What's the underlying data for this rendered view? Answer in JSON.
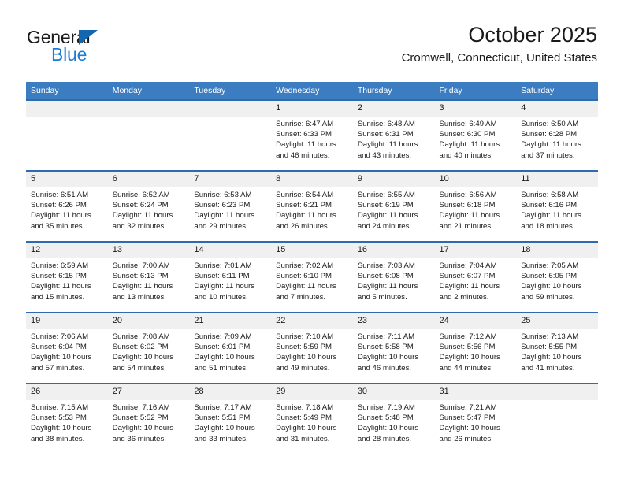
{
  "brand": {
    "line1": "General",
    "line2": "Blue",
    "triangle_color": "#1466b0",
    "blue_color": "#1b7cd6"
  },
  "header": {
    "title": "October 2025",
    "subtitle": "Cromwell, Connecticut, United States"
  },
  "theme": {
    "header_blue": "#3c7cc0",
    "border_blue": "#2e6bad",
    "daynum_bg": "#f0f0f0"
  },
  "columns": [
    "Sunday",
    "Monday",
    "Tuesday",
    "Wednesday",
    "Thursday",
    "Friday",
    "Saturday"
  ],
  "labels": {
    "sunrise": "Sunrise:",
    "sunset": "Sunset:",
    "daylight": "Daylight:"
  },
  "weeks": [
    [
      {
        "day": "",
        "sunrise": "",
        "sunset": "",
        "daylight": ""
      },
      {
        "day": "",
        "sunrise": "",
        "sunset": "",
        "daylight": ""
      },
      {
        "day": "",
        "sunrise": "",
        "sunset": "",
        "daylight": ""
      },
      {
        "day": "1",
        "sunrise": "Sunrise: 6:47 AM",
        "sunset": "Sunset: 6:33 PM",
        "daylight": "Daylight: 11 hours and 46 minutes."
      },
      {
        "day": "2",
        "sunrise": "Sunrise: 6:48 AM",
        "sunset": "Sunset: 6:31 PM",
        "daylight": "Daylight: 11 hours and 43 minutes."
      },
      {
        "day": "3",
        "sunrise": "Sunrise: 6:49 AM",
        "sunset": "Sunset: 6:30 PM",
        "daylight": "Daylight: 11 hours and 40 minutes."
      },
      {
        "day": "4",
        "sunrise": "Sunrise: 6:50 AM",
        "sunset": "Sunset: 6:28 PM",
        "daylight": "Daylight: 11 hours and 37 minutes."
      }
    ],
    [
      {
        "day": "5",
        "sunrise": "Sunrise: 6:51 AM",
        "sunset": "Sunset: 6:26 PM",
        "daylight": "Daylight: 11 hours and 35 minutes."
      },
      {
        "day": "6",
        "sunrise": "Sunrise: 6:52 AM",
        "sunset": "Sunset: 6:24 PM",
        "daylight": "Daylight: 11 hours and 32 minutes."
      },
      {
        "day": "7",
        "sunrise": "Sunrise: 6:53 AM",
        "sunset": "Sunset: 6:23 PM",
        "daylight": "Daylight: 11 hours and 29 minutes."
      },
      {
        "day": "8",
        "sunrise": "Sunrise: 6:54 AM",
        "sunset": "Sunset: 6:21 PM",
        "daylight": "Daylight: 11 hours and 26 minutes."
      },
      {
        "day": "9",
        "sunrise": "Sunrise: 6:55 AM",
        "sunset": "Sunset: 6:19 PM",
        "daylight": "Daylight: 11 hours and 24 minutes."
      },
      {
        "day": "10",
        "sunrise": "Sunrise: 6:56 AM",
        "sunset": "Sunset: 6:18 PM",
        "daylight": "Daylight: 11 hours and 21 minutes."
      },
      {
        "day": "11",
        "sunrise": "Sunrise: 6:58 AM",
        "sunset": "Sunset: 6:16 PM",
        "daylight": "Daylight: 11 hours and 18 minutes."
      }
    ],
    [
      {
        "day": "12",
        "sunrise": "Sunrise: 6:59 AM",
        "sunset": "Sunset: 6:15 PM",
        "daylight": "Daylight: 11 hours and 15 minutes."
      },
      {
        "day": "13",
        "sunrise": "Sunrise: 7:00 AM",
        "sunset": "Sunset: 6:13 PM",
        "daylight": "Daylight: 11 hours and 13 minutes."
      },
      {
        "day": "14",
        "sunrise": "Sunrise: 7:01 AM",
        "sunset": "Sunset: 6:11 PM",
        "daylight": "Daylight: 11 hours and 10 minutes."
      },
      {
        "day": "15",
        "sunrise": "Sunrise: 7:02 AM",
        "sunset": "Sunset: 6:10 PM",
        "daylight": "Daylight: 11 hours and 7 minutes."
      },
      {
        "day": "16",
        "sunrise": "Sunrise: 7:03 AM",
        "sunset": "Sunset: 6:08 PM",
        "daylight": "Daylight: 11 hours and 5 minutes."
      },
      {
        "day": "17",
        "sunrise": "Sunrise: 7:04 AM",
        "sunset": "Sunset: 6:07 PM",
        "daylight": "Daylight: 11 hours and 2 minutes."
      },
      {
        "day": "18",
        "sunrise": "Sunrise: 7:05 AM",
        "sunset": "Sunset: 6:05 PM",
        "daylight": "Daylight: 10 hours and 59 minutes."
      }
    ],
    [
      {
        "day": "19",
        "sunrise": "Sunrise: 7:06 AM",
        "sunset": "Sunset: 6:04 PM",
        "daylight": "Daylight: 10 hours and 57 minutes."
      },
      {
        "day": "20",
        "sunrise": "Sunrise: 7:08 AM",
        "sunset": "Sunset: 6:02 PM",
        "daylight": "Daylight: 10 hours and 54 minutes."
      },
      {
        "day": "21",
        "sunrise": "Sunrise: 7:09 AM",
        "sunset": "Sunset: 6:01 PM",
        "daylight": "Daylight: 10 hours and 51 minutes."
      },
      {
        "day": "22",
        "sunrise": "Sunrise: 7:10 AM",
        "sunset": "Sunset: 5:59 PM",
        "daylight": "Daylight: 10 hours and 49 minutes."
      },
      {
        "day": "23",
        "sunrise": "Sunrise: 7:11 AM",
        "sunset": "Sunset: 5:58 PM",
        "daylight": "Daylight: 10 hours and 46 minutes."
      },
      {
        "day": "24",
        "sunrise": "Sunrise: 7:12 AM",
        "sunset": "Sunset: 5:56 PM",
        "daylight": "Daylight: 10 hours and 44 minutes."
      },
      {
        "day": "25",
        "sunrise": "Sunrise: 7:13 AM",
        "sunset": "Sunset: 5:55 PM",
        "daylight": "Daylight: 10 hours and 41 minutes."
      }
    ],
    [
      {
        "day": "26",
        "sunrise": "Sunrise: 7:15 AM",
        "sunset": "Sunset: 5:53 PM",
        "daylight": "Daylight: 10 hours and 38 minutes."
      },
      {
        "day": "27",
        "sunrise": "Sunrise: 7:16 AM",
        "sunset": "Sunset: 5:52 PM",
        "daylight": "Daylight: 10 hours and 36 minutes."
      },
      {
        "day": "28",
        "sunrise": "Sunrise: 7:17 AM",
        "sunset": "Sunset: 5:51 PM",
        "daylight": "Daylight: 10 hours and 33 minutes."
      },
      {
        "day": "29",
        "sunrise": "Sunrise: 7:18 AM",
        "sunset": "Sunset: 5:49 PM",
        "daylight": "Daylight: 10 hours and 31 minutes."
      },
      {
        "day": "30",
        "sunrise": "Sunrise: 7:19 AM",
        "sunset": "Sunset: 5:48 PM",
        "daylight": "Daylight: 10 hours and 28 minutes."
      },
      {
        "day": "31",
        "sunrise": "Sunrise: 7:21 AM",
        "sunset": "Sunset: 5:47 PM",
        "daylight": "Daylight: 10 hours and 26 minutes."
      },
      {
        "day": "",
        "sunrise": "",
        "sunset": "",
        "daylight": ""
      }
    ]
  ]
}
